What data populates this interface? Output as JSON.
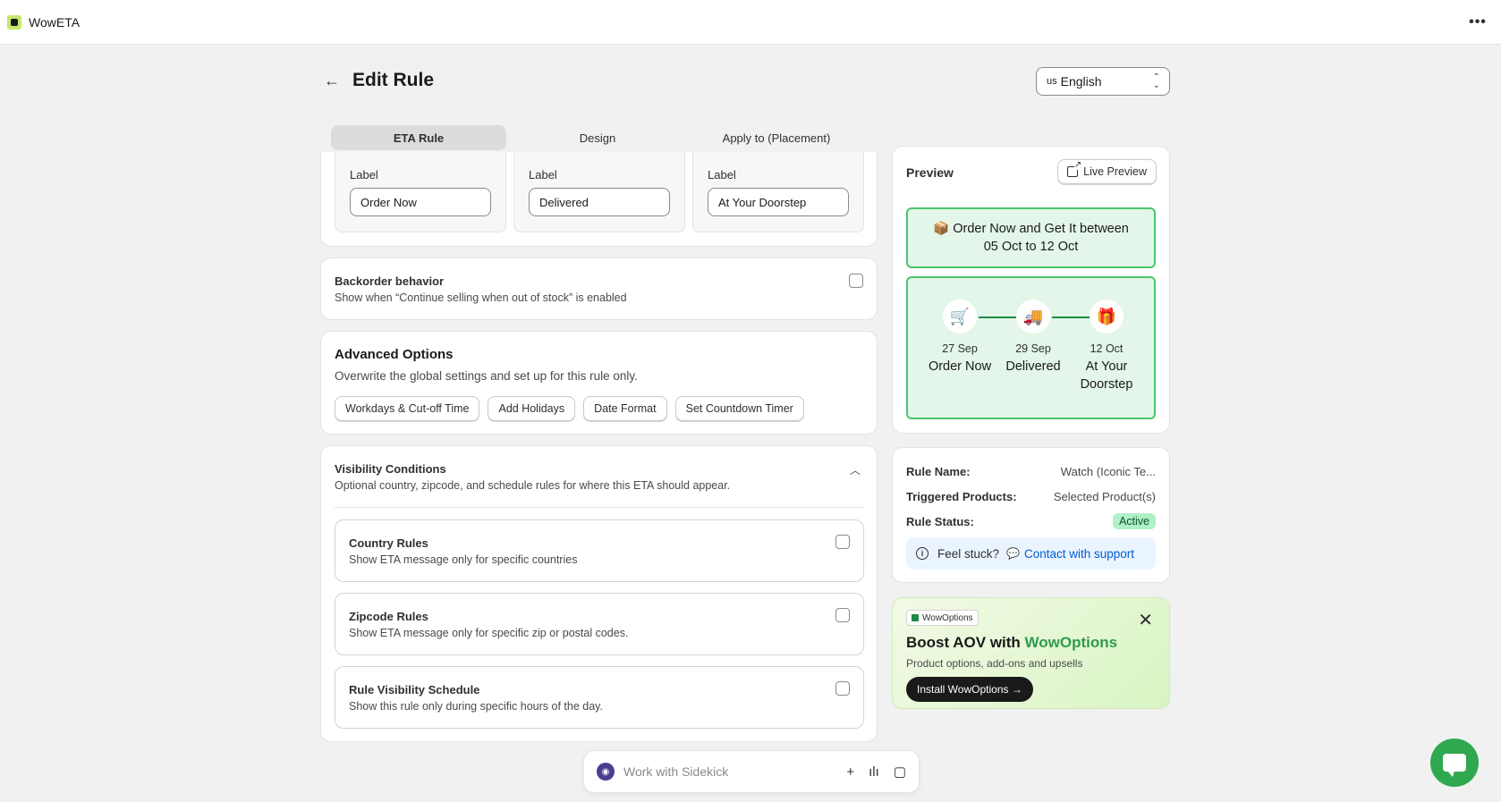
{
  "app": {
    "name": "WowETA",
    "more_icon": "ellipsis-icon"
  },
  "header": {
    "title": "Edit Rule",
    "language": {
      "flag": "us",
      "value": "English"
    }
  },
  "tabs": [
    {
      "label": "ETA Rule",
      "active": true
    },
    {
      "label": "Design",
      "active": false
    },
    {
      "label": "Apply to (Placement)",
      "active": false
    }
  ],
  "labels": [
    {
      "label": "Label",
      "value": "Order Now"
    },
    {
      "label": "Label",
      "value": "Delivered"
    },
    {
      "label": "Label",
      "value": "At Your Doorstep"
    }
  ],
  "backorder": {
    "title": "Backorder behavior",
    "subtitle": "Show when “Continue selling when out of stock” is enabled",
    "checked": false
  },
  "advanced": {
    "title": "Advanced Options",
    "subtitle": "Overwrite the global settings and set up for this rule only.",
    "buttons": [
      "Workdays & Cut-off Time",
      "Add Holidays",
      "Date Format",
      "Set Countdown Timer"
    ]
  },
  "visibility": {
    "title": "Visibility Conditions",
    "subtitle": "Optional country, zipcode, and schedule rules for where this ETA should appear.",
    "rules": [
      {
        "title": "Country Rules",
        "subtitle": "Show ETA message only for specific countries",
        "checked": false
      },
      {
        "title": "Zipcode Rules",
        "subtitle": "Show ETA message only for specific zip or postal codes.",
        "checked": false
      },
      {
        "title": "Rule Visibility Schedule",
        "subtitle": "Show this rule only during specific hours of the day.",
        "checked": false
      }
    ]
  },
  "preview": {
    "title": "Preview",
    "live_preview_label": "Live Preview",
    "eta_message_line1": "📦 Order Now and Get It between",
    "eta_message_line2": "05 Oct to 12 Oct",
    "steps": [
      {
        "icon": "🛒",
        "date": "27 Sep",
        "label": "Order Now"
      },
      {
        "icon": "🚚",
        "date": "29 Sep",
        "label": "Delivered"
      },
      {
        "icon": "🎁",
        "date": "12 Oct",
        "label": "At Your Doorstep"
      }
    ]
  },
  "info": {
    "rule_name_key": "Rule Name:",
    "rule_name_value": "Watch (Iconic Te...",
    "triggered_key": "Triggered Products:",
    "triggered_value": "Selected Product(s)",
    "status_key": "Rule Status:",
    "status_value": "Active",
    "stuck_text": "Feel stuck?",
    "support_link": "Contact with support"
  },
  "promo": {
    "logo_text": "WowOptions",
    "title_prefix": "Boost AOV with ",
    "title_highlight": "WowOptions",
    "subtitle": "Product options, add-ons and upsells",
    "button": "Install WowOptions →"
  },
  "sidekick": {
    "placeholder": "Work with Sidekick"
  },
  "colors": {
    "accent_green": "#4cc46f",
    "status_green": "#aff1c7",
    "link_blue": "#005bd3"
  }
}
